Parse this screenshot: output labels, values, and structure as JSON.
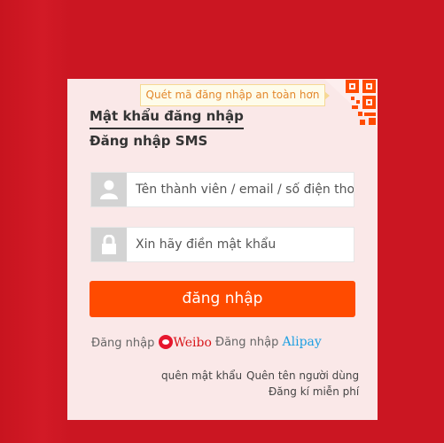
{
  "login": {
    "qr_tip": "Quét mã đăng nhập an toàn hơn",
    "tabs": {
      "password": "Mật khẩu đăng nhập",
      "sms": "Đăng nhập SMS"
    },
    "username_placeholder": "Tên thành viên / email / số điện thoại",
    "password_placeholder": "Xin hãy điền mật khẩu",
    "submit_label": "đăng nhập",
    "social": {
      "weibo_prefix": "Đăng nhập",
      "weibo_name": "Weibo",
      "alipay_prefix": "Đăng nhập",
      "alipay_name": "Alipay"
    },
    "links": {
      "forgot_password": "quên mật khẩu",
      "forgot_username": "Quên tên người dùng",
      "register": "Đăng kí miễn phí"
    }
  },
  "colors": {
    "background": "#cb1622",
    "panel": "#fae8e8",
    "button": "#ff4b00",
    "weibo": "#d8171b",
    "alipay": "#1d9fe2"
  },
  "icons": [
    "qr-code-icon",
    "user-icon",
    "lock-icon",
    "weibo-icon"
  ]
}
